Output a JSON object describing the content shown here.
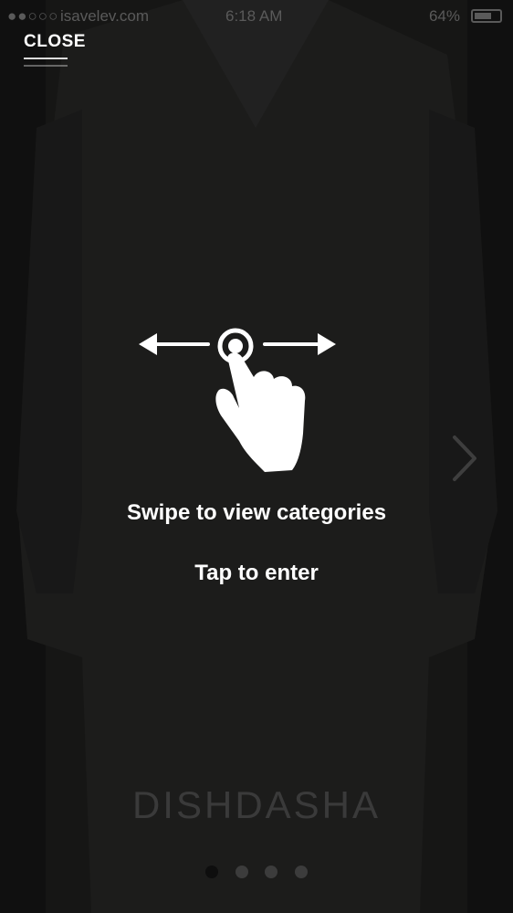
{
  "status_bar": {
    "signal": "●●○○○",
    "carrier": "isavelev.com",
    "time": "6:18 AM",
    "battery": "64%"
  },
  "header": {
    "close_label": "CLOSE"
  },
  "instructions": {
    "swipe": "Swipe to view categories",
    "tap": "Tap to enter"
  },
  "category": {
    "title": "DISHDASHA"
  },
  "pagination": {
    "total": 4,
    "active_index": 0
  },
  "icons": {
    "gesture": "swipe-hand-icon",
    "next": "chevron-right-icon"
  }
}
